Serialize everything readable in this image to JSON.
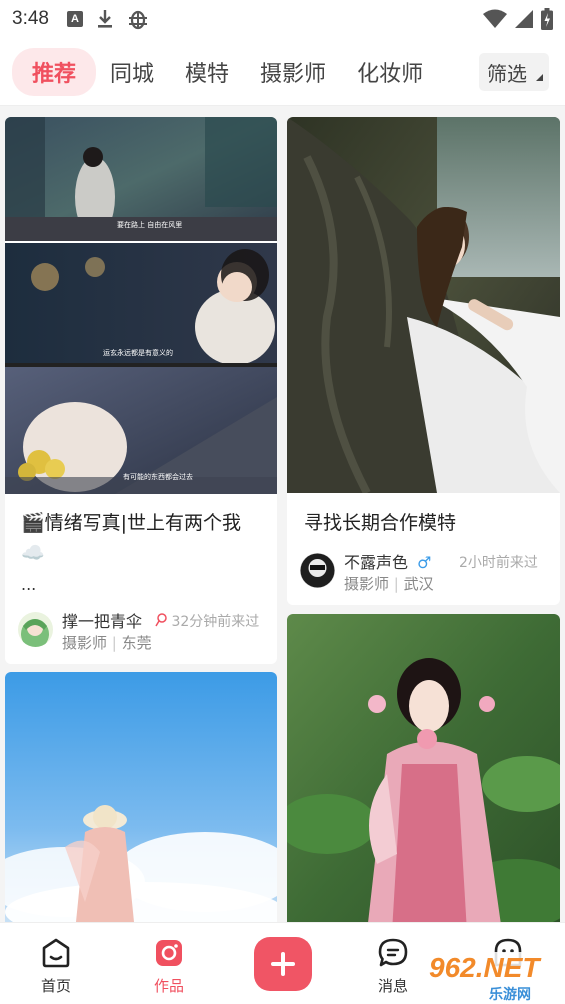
{
  "status_bar": {
    "time": "3:48",
    "notification_letter": "A"
  },
  "tabs": [
    {
      "label": "推荐",
      "active": true
    },
    {
      "label": "同城",
      "active": false
    },
    {
      "label": "模特",
      "active": false
    },
    {
      "label": "摄影师",
      "active": false
    },
    {
      "label": "化妆师",
      "active": false
    }
  ],
  "filter": {
    "label": "筛选"
  },
  "cards": [
    {
      "title": "🎬情绪写真|世上有两个我",
      "title_line2": "☁️",
      "ellipsis": "...",
      "author": "撑一把青伞",
      "role": "摄影师",
      "city": "东莞",
      "time": "32分钟前来过",
      "image_captions": [
        "要在路上 自由在风里",
        "运玄永远都是有意义的",
        "有可能的东西都会过去"
      ]
    },
    {
      "title": "寻找长期合作模特",
      "author": "不露声色",
      "gender_icon": "♂",
      "role": "摄影师",
      "city": "武汉",
      "time": "2小时前来过"
    }
  ],
  "bottom_nav": [
    {
      "label": "首页",
      "active": false
    },
    {
      "label": "作品",
      "active": true
    },
    {
      "label": "",
      "active": false
    },
    {
      "label": "消息",
      "active": false
    },
    {
      "label": "",
      "active": false
    }
  ],
  "watermark": {
    "big": "962.NET",
    "small": "乐游网"
  },
  "colors": {
    "accent": "#f0505f",
    "tab_active_bg": "#fde8ea",
    "plus_button": "#f05565"
  }
}
